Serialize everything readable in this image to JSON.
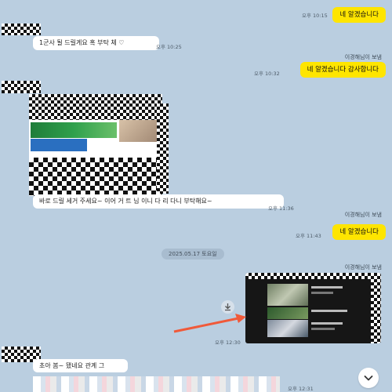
{
  "messages": {
    "m1": {
      "text": "네 알겠습니다",
      "time": "오후 10:15"
    },
    "m2": {
      "text": "1군사 될 드릴게요 혹 부탁 체 ♡",
      "time": "오후 10:25"
    },
    "m3": {
      "sender": "이경해님이 보냄",
      "text": "네 알겠습니다 감사합니다",
      "time": "오후 10:32"
    },
    "m4": {
      "text": "바로 드릴 세거 주세요~ 이어 거 트 님 이니 다 리 다니 부탁해요~",
      "time": "오후 11:36"
    },
    "m5": {
      "sender": "이경해님이 보냄",
      "text": "네 알겠습니다",
      "time": "오후 11:43"
    },
    "date_divider": "2025.05.17 토요일",
    "m6": {
      "sender": "이경해님이 보냄",
      "time": "오후 12:30"
    },
    "m7": {
      "text": "초아 봄~ 됐네요 관계 그",
      "time": "오후 12:31"
    }
  },
  "colors": {
    "background": "#bacee0",
    "my_bubble": "#fee500",
    "other_bubble": "#ffffff",
    "arrow": "#f05a3a"
  },
  "icons": {
    "download": "download-icon",
    "scroll_down": "chevron-down-icon"
  }
}
